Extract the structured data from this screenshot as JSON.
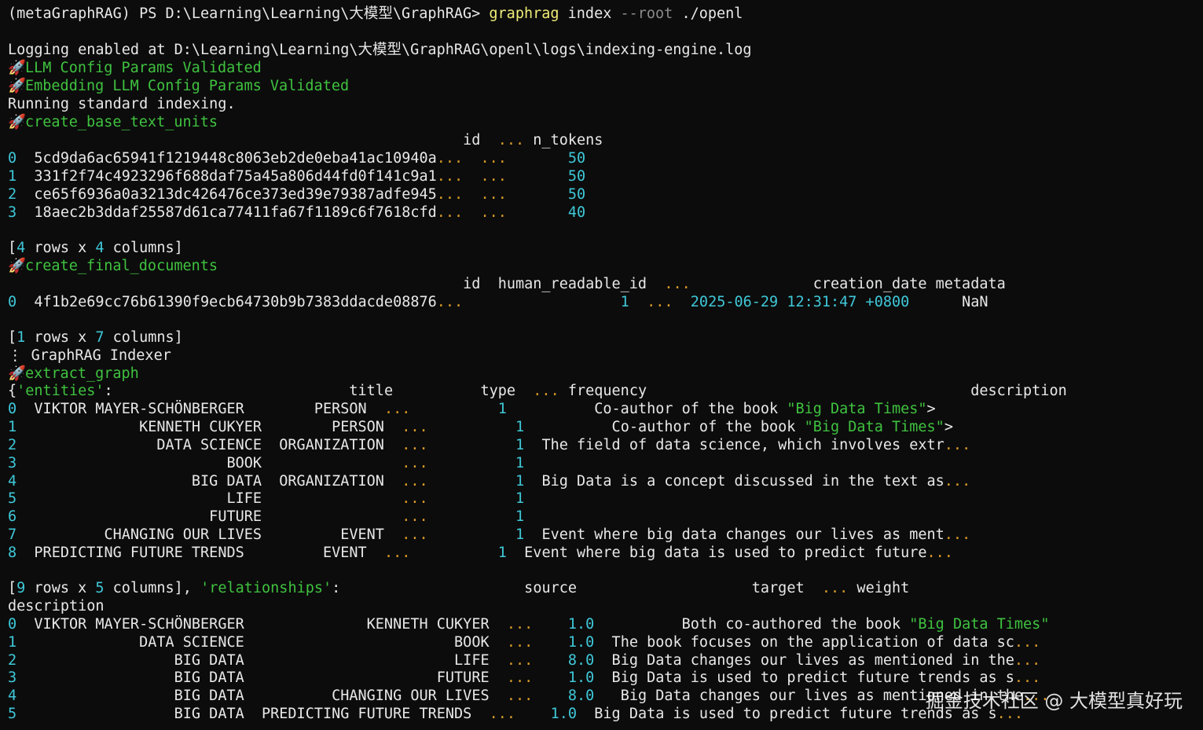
{
  "colors": {
    "background": "#0c0c0c",
    "text": "#e8e8e8",
    "command": "#f0ec78",
    "flag": "#8a8a8a",
    "success": "#3fc23f",
    "number": "#3fc8d8",
    "ellipsis": "#d99a28"
  },
  "icons": {
    "step": "rocket-icon"
  },
  "prompt": {
    "prefix": "(metaGraphRAG) PS D:\\Learning\\Learning\\大模型\\GraphRAG> ",
    "cmd": "graphrag",
    "arg1": " index ",
    "flag": "--root",
    "arg2": " ./openl"
  },
  "log": {
    "logging": "Logging enabled at D:\\Learning\\Learning\\大模型\\GraphRAG\\openl\\logs\\indexing-engine.log",
    "llm": "LLM Config Params Validated",
    "embedding": "Embedding LLM Config Params Validated",
    "running": "Running standard indexing."
  },
  "steps": {
    "text_units": "create_base_text_units",
    "final_documents": "create_final_documents",
    "indexer": "GraphRAG Indexer",
    "extract_graph": "extract_graph"
  },
  "text_units": {
    "header": [
      {
        "t": "                                                    id  "
      },
      {
        "t": "...",
        "c": "org"
      },
      {
        "t": " n_tokens"
      }
    ],
    "rows": [
      [
        {
          "t": "0",
          "c": "cyn"
        },
        {
          "t": "  5cd9da6ac65941f1219448c8063eb2de0eba41ac10940a"
        },
        {
          "t": "...",
          "c": "org"
        },
        {
          "t": "  "
        },
        {
          "t": "...",
          "c": "org"
        },
        {
          "t": "       "
        },
        {
          "t": "50",
          "c": "cyn"
        }
      ],
      [
        {
          "t": "1",
          "c": "cyn"
        },
        {
          "t": "  331f2f74c4923296f688daf75a45a806d44fd0f141c9a1"
        },
        {
          "t": "...",
          "c": "org"
        },
        {
          "t": "  "
        },
        {
          "t": "...",
          "c": "org"
        },
        {
          "t": "       "
        },
        {
          "t": "50",
          "c": "cyn"
        }
      ],
      [
        {
          "t": "2",
          "c": "cyn"
        },
        {
          "t": "  ce65f6936a0a3213dc426476ce373ed39e79387adfe945"
        },
        {
          "t": "...",
          "c": "org"
        },
        {
          "t": "  "
        },
        {
          "t": "...",
          "c": "org"
        },
        {
          "t": "       "
        },
        {
          "t": "50",
          "c": "cyn"
        }
      ],
      [
        {
          "t": "3",
          "c": "cyn"
        },
        {
          "t": "  18aec2b3ddaf25587d61ca77411fa67f1189c6f7618cfd"
        },
        {
          "t": "...",
          "c": "org"
        },
        {
          "t": "  "
        },
        {
          "t": "...",
          "c": "org"
        },
        {
          "t": "       "
        },
        {
          "t": "40",
          "c": "cyn"
        }
      ]
    ],
    "summary": [
      {
        "t": "["
      },
      {
        "t": "4",
        "c": "cyn"
      },
      {
        "t": " rows x "
      },
      {
        "t": "4",
        "c": "cyn"
      },
      {
        "t": " columns]"
      }
    ]
  },
  "final_documents": {
    "header": [
      {
        "t": "                                                    id  human_readable_id  "
      },
      {
        "t": "...",
        "c": "org"
      },
      {
        "t": "              creation_date metadata"
      }
    ],
    "row": [
      {
        "t": "0",
        "c": "cyn"
      },
      {
        "t": "  4f1b2e69cc76b61390f9ecb64730b9b7383ddacde08876"
      },
      {
        "t": "...",
        "c": "org"
      },
      {
        "t": "                  "
      },
      {
        "t": "1",
        "c": "cyn"
      },
      {
        "t": "  "
      },
      {
        "t": "...",
        "c": "org"
      },
      {
        "t": "  "
      },
      {
        "t": "2025-06-29 12:31:47 +0800",
        "c": "cyn"
      },
      {
        "t": "      NaN"
      }
    ],
    "summary": [
      {
        "t": "["
      },
      {
        "t": "1",
        "c": "cyn"
      },
      {
        "t": " rows x "
      },
      {
        "t": "7",
        "c": "cyn"
      },
      {
        "t": " columns]"
      }
    ]
  },
  "entities": {
    "header": [
      {
        "t": "{"
      },
      {
        "t": "'entities'",
        "c": "grn"
      },
      {
        "t": ":                           title          type  "
      },
      {
        "t": "...",
        "c": "org"
      },
      {
        "t": " frequency                                     description"
      }
    ],
    "rows": [
      [
        {
          "t": "0",
          "c": "cyn"
        },
        {
          "t": "  VIKTOR MAYER-SCHÖNBERGER        PERSON  "
        },
        {
          "t": "...",
          "c": "org"
        },
        {
          "t": "          "
        },
        {
          "t": "1",
          "c": "cyn"
        },
        {
          "t": "          Co-author of the book "
        },
        {
          "t": "\"Big Data Times\"",
          "c": "grn"
        },
        {
          "t": ">"
        }
      ],
      [
        {
          "t": "1",
          "c": "cyn"
        },
        {
          "t": "              KENNETH CUKYER        PERSON  "
        },
        {
          "t": "...",
          "c": "org"
        },
        {
          "t": "          "
        },
        {
          "t": "1",
          "c": "cyn"
        },
        {
          "t": "          Co-author of the book "
        },
        {
          "t": "\"Big Data Times\"",
          "c": "grn"
        },
        {
          "t": ">"
        }
      ],
      [
        {
          "t": "2",
          "c": "cyn"
        },
        {
          "t": "                DATA SCIENCE  ORGANIZATION  "
        },
        {
          "t": "...",
          "c": "org"
        },
        {
          "t": "          "
        },
        {
          "t": "1",
          "c": "cyn"
        },
        {
          "t": "  The field of data science, which involves extr"
        },
        {
          "t": "...",
          "c": "org"
        }
      ],
      [
        {
          "t": "3",
          "c": "cyn"
        },
        {
          "t": "                        BOOK                "
        },
        {
          "t": "...",
          "c": "org"
        },
        {
          "t": "          "
        },
        {
          "t": "1",
          "c": "cyn"
        }
      ],
      [
        {
          "t": "4",
          "c": "cyn"
        },
        {
          "t": "                    BIG DATA  ORGANIZATION  "
        },
        {
          "t": "...",
          "c": "org"
        },
        {
          "t": "          "
        },
        {
          "t": "1",
          "c": "cyn"
        },
        {
          "t": "  Big Data is a concept discussed in the text as"
        },
        {
          "t": "...",
          "c": "org"
        }
      ],
      [
        {
          "t": "5",
          "c": "cyn"
        },
        {
          "t": "                        LIFE                "
        },
        {
          "t": "...",
          "c": "org"
        },
        {
          "t": "          "
        },
        {
          "t": "1",
          "c": "cyn"
        }
      ],
      [
        {
          "t": "6",
          "c": "cyn"
        },
        {
          "t": "                      FUTURE                "
        },
        {
          "t": "...",
          "c": "org"
        },
        {
          "t": "          "
        },
        {
          "t": "1",
          "c": "cyn"
        }
      ],
      [
        {
          "t": "7",
          "c": "cyn"
        },
        {
          "t": "          CHANGING OUR LIVES         EVENT  "
        },
        {
          "t": "...",
          "c": "org"
        },
        {
          "t": "          "
        },
        {
          "t": "1",
          "c": "cyn"
        },
        {
          "t": "  Event where big data changes our lives as ment"
        },
        {
          "t": "...",
          "c": "org"
        }
      ],
      [
        {
          "t": "8",
          "c": "cyn"
        },
        {
          "t": "  PREDICTING FUTURE TRENDS         EVENT  "
        },
        {
          "t": "...",
          "c": "org"
        },
        {
          "t": "          "
        },
        {
          "t": "1",
          "c": "cyn"
        },
        {
          "t": "  Event where big data is used to predict future"
        },
        {
          "t": "...",
          "c": "org"
        }
      ]
    ]
  },
  "relationships": {
    "header": [
      {
        "t": "["
      },
      {
        "t": "9",
        "c": "cyn"
      },
      {
        "t": " rows x "
      },
      {
        "t": "5",
        "c": "cyn"
      },
      {
        "t": " columns], "
      },
      {
        "t": "'relationships'",
        "c": "grn"
      },
      {
        "t": ":                     source                    target  "
      },
      {
        "t": "...",
        "c": "org"
      },
      {
        "t": " weight"
      }
    ],
    "header2": [
      {
        "t": "description"
      }
    ],
    "rows": [
      [
        {
          "t": "0",
          "c": "cyn"
        },
        {
          "t": "  VIKTOR MAYER-SCHÖNBERGER              KENNETH CUKYER  "
        },
        {
          "t": "...",
          "c": "org"
        },
        {
          "t": "    "
        },
        {
          "t": "1.0",
          "c": "cyn"
        },
        {
          "t": "          Both co-authored the book "
        },
        {
          "t": "\"Big Data Times\"",
          "c": "grn"
        }
      ],
      [
        {
          "t": "1",
          "c": "cyn"
        },
        {
          "t": "              DATA SCIENCE                        BOOK  "
        },
        {
          "t": "...",
          "c": "org"
        },
        {
          "t": "    "
        },
        {
          "t": "1.0",
          "c": "cyn"
        },
        {
          "t": "  The book focuses on the application of data sc"
        },
        {
          "t": "...",
          "c": "org"
        }
      ],
      [
        {
          "t": "2",
          "c": "cyn"
        },
        {
          "t": "                  BIG DATA                        LIFE  "
        },
        {
          "t": "...",
          "c": "org"
        },
        {
          "t": "    "
        },
        {
          "t": "8.0",
          "c": "cyn"
        },
        {
          "t": "  Big Data changes our lives as mentioned in the"
        },
        {
          "t": "...",
          "c": "org"
        }
      ],
      [
        {
          "t": "3",
          "c": "cyn"
        },
        {
          "t": "                  BIG DATA                      FUTURE  "
        },
        {
          "t": "...",
          "c": "org"
        },
        {
          "t": "    "
        },
        {
          "t": "1.0",
          "c": "cyn"
        },
        {
          "t": "  Big Data is used to predict future trends as s"
        },
        {
          "t": "...",
          "c": "org"
        }
      ],
      [
        {
          "t": "4",
          "c": "cyn"
        },
        {
          "t": "                  BIG DATA          CHANGING OUR LIVES  "
        },
        {
          "t": "...",
          "c": "org"
        },
        {
          "t": "    "
        },
        {
          "t": "8.0",
          "c": "cyn"
        },
        {
          "t": "   Big Data changes our lives as mentioned in the"
        },
        {
          "t": "...",
          "c": "org"
        }
      ],
      [
        {
          "t": "5",
          "c": "cyn"
        },
        {
          "t": "                  BIG DATA  PREDICTING FUTURE TRENDS  "
        },
        {
          "t": "...",
          "c": "org"
        },
        {
          "t": "    "
        },
        {
          "t": "1.0",
          "c": "cyn"
        },
        {
          "t": "  Big Data is used to predict future trends as s"
        },
        {
          "t": "...",
          "c": "org"
        }
      ]
    ]
  },
  "watermark": "掘金技术社区 @ 大模型真好玩"
}
